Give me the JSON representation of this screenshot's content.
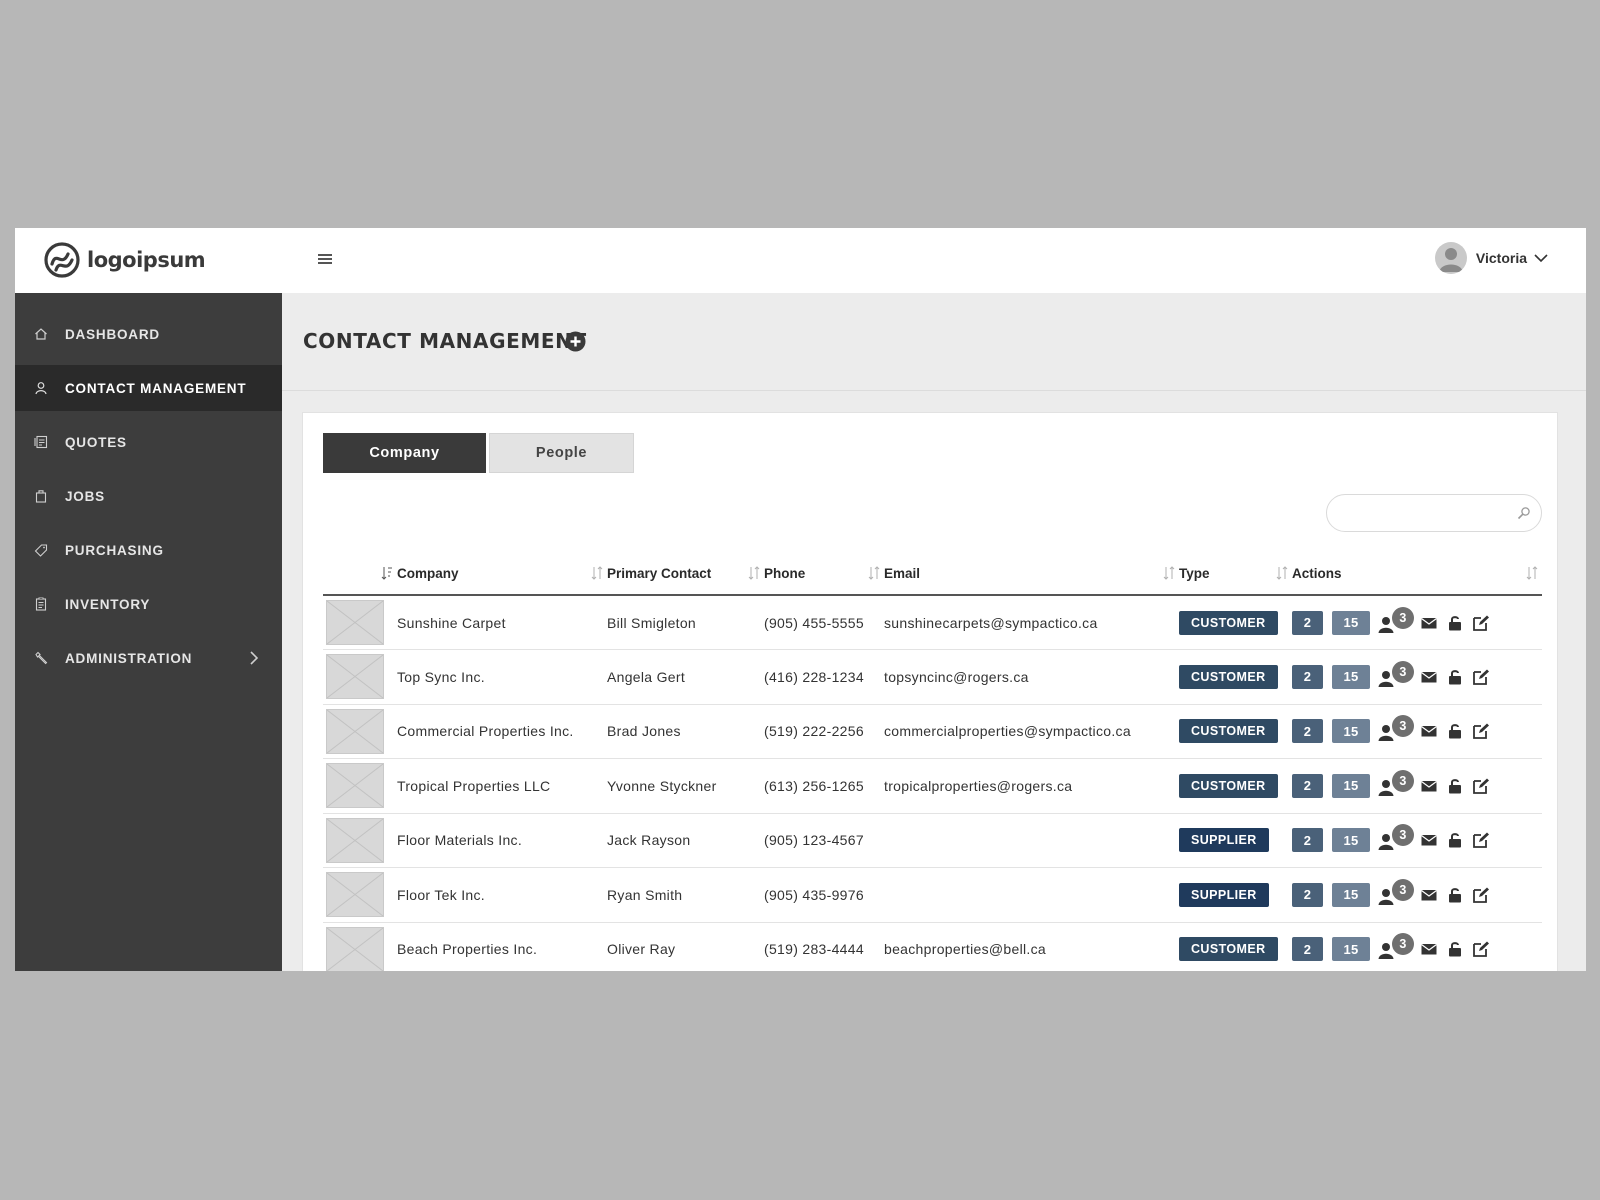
{
  "brand": {
    "name": "logoipsum"
  },
  "user": {
    "name": "Victoria"
  },
  "nav": [
    {
      "label": "DASHBOARD",
      "icon": "home-icon",
      "active": false
    },
    {
      "label": "CONTACT MANAGEMENT",
      "icon": "user-icon",
      "active": true
    },
    {
      "label": "QUOTES",
      "icon": "quotes-icon",
      "active": false
    },
    {
      "label": "JOBS",
      "icon": "briefcase-icon",
      "active": false
    },
    {
      "label": "PURCHASING",
      "icon": "tag-icon",
      "active": false
    },
    {
      "label": "INVENTORY",
      "icon": "clipboard-icon",
      "active": false
    },
    {
      "label": "ADMINISTRATION",
      "icon": "wrench-icon",
      "active": false
    }
  ],
  "page": {
    "title": "CONTACT MANAGEMENT"
  },
  "tabs": {
    "company": "Company",
    "people": "People"
  },
  "search": {
    "placeholder": ""
  },
  "table": {
    "headers": [
      "Company",
      "Primary Contact",
      "Phone",
      "Email",
      "Type",
      "Actions"
    ],
    "rows": [
      {
        "company": "Sunshine Carpet",
        "contact": "Bill Smigleton",
        "phone": "(905) 455-5555",
        "email": "sunshinecarpets@sympactico.ca",
        "type": "CUSTOMER",
        "a": "2",
        "b": "15",
        "people": "3"
      },
      {
        "company": "Top Sync Inc.",
        "contact": "Angela Gert",
        "phone": "(416) 228-1234",
        "email": "topsyncinc@rogers.ca",
        "type": "CUSTOMER",
        "a": "2",
        "b": "15",
        "people": "3"
      },
      {
        "company": "Commercial Properties Inc.",
        "contact": "Brad Jones",
        "phone": "(519) 222-2256",
        "email": "commercialproperties@sympactico.ca",
        "type": "CUSTOMER",
        "a": "2",
        "b": "15",
        "people": "3"
      },
      {
        "company": "Tropical Properties LLC",
        "contact": "Yvonne Styckner",
        "phone": "(613) 256-1265",
        "email": "tropicalproperties@rogers.ca",
        "type": "CUSTOMER",
        "a": "2",
        "b": "15",
        "people": "3"
      },
      {
        "company": "Floor Materials Inc.",
        "contact": "Jack Rayson",
        "phone": "(905) 123-4567",
        "email": "",
        "type": "SUPPLIER",
        "a": "2",
        "b": "15",
        "people": "3"
      },
      {
        "company": "Floor Tek Inc.",
        "contact": "Ryan Smith",
        "phone": "(905) 435-9976",
        "email": "",
        "type": "SUPPLIER",
        "a": "2",
        "b": "15",
        "people": "3"
      },
      {
        "company": "Beach Properties Inc.",
        "contact": "Oliver Ray",
        "phone": "(519) 283-4444",
        "email": "beachproperties@bell.ca",
        "type": "CUSTOMER",
        "a": "2",
        "b": "15",
        "people": "3"
      }
    ]
  },
  "colors": {
    "sidebar": "#3d3d3d",
    "sidebar_active": "#2a2a2a",
    "customer": "#2f4a63",
    "supplier": "#1f3a5c"
  }
}
